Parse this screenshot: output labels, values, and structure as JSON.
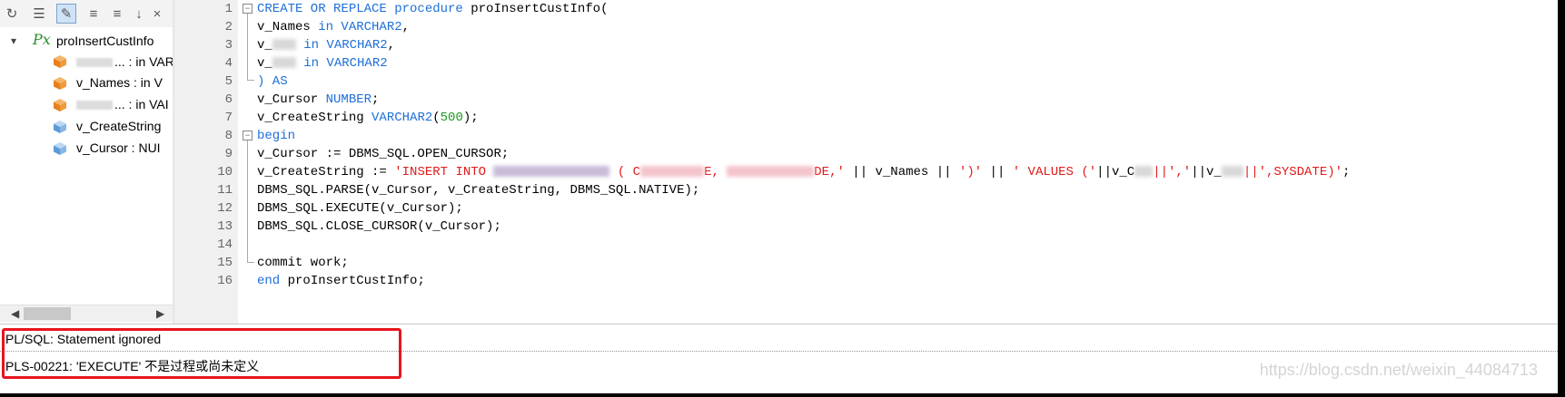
{
  "toolbar": {
    "buttons": [
      {
        "name": "refresh-icon",
        "glyph": "↻"
      },
      {
        "name": "list-icon",
        "glyph": "☰"
      },
      {
        "name": "edit-icon",
        "glyph": "✎"
      },
      {
        "name": "sort-icon",
        "glyph": "≡"
      },
      {
        "name": "filter-icon",
        "glyph": "≡"
      },
      {
        "name": "arrow-down-icon",
        "glyph": "↓"
      },
      {
        "name": "close-icon",
        "glyph": "×"
      }
    ]
  },
  "tree": {
    "root_label": "proInsertCustInfo",
    "items": [
      {
        "label": "... : in VAR",
        "color": "orange"
      },
      {
        "label": "v_Names : in V",
        "color": "orange"
      },
      {
        "label": "... : in VAI",
        "color": "orange"
      },
      {
        "label": "v_CreateString",
        "color": "blue"
      },
      {
        "label": "v_Cursor : NUI",
        "color": "blue"
      }
    ]
  },
  "code": {
    "line_numbers": [
      "1",
      "2",
      "3",
      "4",
      "5",
      "6",
      "7",
      "8",
      "9",
      "10",
      "11",
      "12",
      "13",
      "14",
      "15",
      "16"
    ],
    "l1_kw": "CREATE OR REPLACE procedure",
    "l1_rest": " proInsertCustInfo(",
    "l2_a": "v_Names ",
    "l2_kw": "in VARCHAR2",
    "l2_b": ",",
    "l3_a": "v_",
    "l3_kw": "in VARCHAR2",
    "l3_b": ",",
    "l4_a": "v_",
    "l4_kw": "in VARCHAR2",
    "l5": ") AS",
    "l6_a": "v_Cursor ",
    "l6_kw": "NUMBER",
    "l6_b": ";",
    "l7_a": "v_CreateString ",
    "l7_kw": "VARCHAR2",
    "l7_b": "(",
    "l7_num": "500",
    "l7_c": ");",
    "l8": "begin",
    "l9": "v_Cursor := DBMS_SQL.OPEN_CURSOR;",
    "l10_a": "v_CreateString := ",
    "l10_s1": "'INSERT INTO ",
    "l10_s2": " ( C",
    "l10_s3": "E, ",
    "l10_s4": "DE,'",
    "l10_b": " || v_Names || ",
    "l10_s5": "')'",
    "l10_c": " || ",
    "l10_s6": "' VALUES ('",
    "l10_d": "||v_C",
    "l10_s7": "||','",
    "l10_e": "||v_",
    "l10_s8": "||',SYSDATE)'",
    "l10_f": ";",
    "l11": "DBMS_SQL.PARSE(v_Cursor, v_CreateString, DBMS_SQL.NATIVE);",
    "l12": "DBMS_SQL.EXECUTE(v_Cursor);",
    "l13": "DBMS_SQL.CLOSE_CURSOR(v_Cursor);",
    "l15": "commit work;",
    "l16_kw": "end",
    "l16_rest": " proInsertCustInfo;"
  },
  "messages": {
    "line1": "PL/SQL: Statement ignored",
    "line2": "PLS-00221: 'EXECUTE' 不是过程或尚未定义"
  },
  "watermark": "https://blog.csdn.net/weixin_44084713",
  "colors": {
    "keyword": "#1e6fd8",
    "string": "#e21a1a",
    "number": "#1a9a1a",
    "error_box": "#e8141e"
  }
}
